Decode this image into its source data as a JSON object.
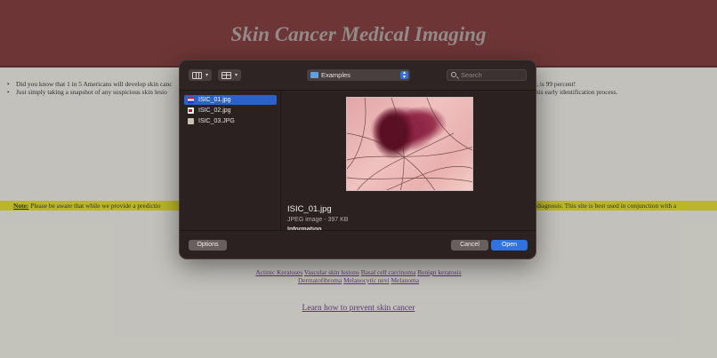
{
  "page": {
    "title": "Skin Cancer Medical Imaging",
    "intro": [
      {
        "left": "Did you know that 1 in 5 Americans will develop skin canc",
        "right": "y, is 99 percent!"
      },
      {
        "left": "Just simply taking a snapshot of any suspicious skin lesio",
        "right": "this early identification process."
      }
    ],
    "note": {
      "label": "Note:",
      "text": " Please be aware that while we provide a predictio",
      "tail": "al diagnosis. This site is best used in conjunction with a"
    },
    "categories": {
      "row1": [
        "Actinic Keratoses",
        "Vascular skin lesions",
        "Basal cell carcinoma",
        "Benign keratosis"
      ],
      "row2": [
        "Dermatofibroma",
        "Melanocytic nevi",
        "Melanoma"
      ]
    },
    "learn_link": "Learn how to prevent skin cancer"
  },
  "dialog": {
    "location": "Examples",
    "search_placeholder": "Search",
    "files": [
      {
        "name": "ISIC_01.jpg",
        "icon": "flag-thumbnail-icon",
        "selected": true
      },
      {
        "name": "ISIC_02.jpg",
        "icon": "image-thumbnail-icon",
        "selected": false
      },
      {
        "name": "ISIC_03.JPG",
        "icon": "document-thumbnail-icon",
        "selected": false
      }
    ],
    "preview": {
      "filename": "ISIC_01.jpg",
      "meta": "JPEG image - 397 KB",
      "info_heading": "Information"
    },
    "buttons": {
      "options": "Options",
      "cancel": "Cancel",
      "open": "Open"
    },
    "colors": {
      "accent": "#2f72e0",
      "selection": "#2a62c9",
      "panel": "#2b2121"
    }
  }
}
